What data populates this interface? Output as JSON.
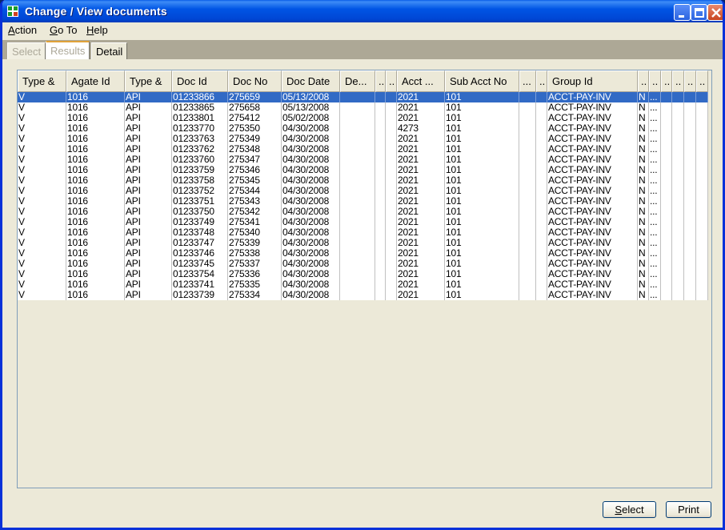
{
  "window": {
    "title": "Change / View documents"
  },
  "menu": [
    {
      "label": "Action",
      "key": "A",
      "rest": "ction"
    },
    {
      "label": "Go To",
      "key": "G",
      "rest": "o To"
    },
    {
      "label": "Help",
      "key": "H",
      "rest": "elp"
    }
  ],
  "tabs": [
    "Select",
    "Results",
    "Detail"
  ],
  "columns": [
    "Type &",
    "Agate Id",
    "Type &",
    "Doc Id",
    "Doc No",
    "Doc Date",
    "De...",
    "..",
    "..",
    "Acct ...",
    "Sub Acct No",
    "...",
    "..",
    "Group Id",
    "..",
    "..",
    "..",
    "..",
    "..",
    ".."
  ],
  "rows": [
    [
      "V",
      "1016",
      "API",
      "01233866",
      "275659",
      "05/13/2008",
      "",
      "",
      "",
      "2021",
      "101",
      "",
      "",
      "ACCT-PAY-INV",
      "N",
      "...",
      "",
      "",
      "",
      ""
    ],
    [
      "V",
      "1016",
      "API",
      "01233865",
      "275658",
      "05/13/2008",
      "",
      "",
      "",
      "2021",
      "101",
      "",
      "",
      "ACCT-PAY-INV",
      "N",
      "...",
      "",
      "",
      "",
      ""
    ],
    [
      "V",
      "1016",
      "API",
      "01233801",
      "275412",
      "05/02/2008",
      "",
      "",
      "",
      "2021",
      "101",
      "",
      "",
      "ACCT-PAY-INV",
      "N",
      "...",
      "",
      "",
      "",
      ""
    ],
    [
      "V",
      "1016",
      "API",
      "01233770",
      "275350",
      "04/30/2008",
      "",
      "",
      "",
      "4273",
      "101",
      "",
      "",
      "ACCT-PAY-INV",
      "N",
      "...",
      "",
      "",
      "",
      ""
    ],
    [
      "V",
      "1016",
      "API",
      "01233763",
      "275349",
      "04/30/2008",
      "",
      "",
      "",
      "2021",
      "101",
      "",
      "",
      "ACCT-PAY-INV",
      "N",
      "...",
      "",
      "",
      "",
      ""
    ],
    [
      "V",
      "1016",
      "API",
      "01233762",
      "275348",
      "04/30/2008",
      "",
      "",
      "",
      "2021",
      "101",
      "",
      "",
      "ACCT-PAY-INV",
      "N",
      "...",
      "",
      "",
      "",
      ""
    ],
    [
      "V",
      "1016",
      "API",
      "01233760",
      "275347",
      "04/30/2008",
      "",
      "",
      "",
      "2021",
      "101",
      "",
      "",
      "ACCT-PAY-INV",
      "N",
      "...",
      "",
      "",
      "",
      ""
    ],
    [
      "V",
      "1016",
      "API",
      "01233759",
      "275346",
      "04/30/2008",
      "",
      "",
      "",
      "2021",
      "101",
      "",
      "",
      "ACCT-PAY-INV",
      "N",
      "...",
      "",
      "",
      "",
      ""
    ],
    [
      "V",
      "1016",
      "API",
      "01233758",
      "275345",
      "04/30/2008",
      "",
      "",
      "",
      "2021",
      "101",
      "",
      "",
      "ACCT-PAY-INV",
      "N",
      "...",
      "",
      "",
      "",
      ""
    ],
    [
      "V",
      "1016",
      "API",
      "01233752",
      "275344",
      "04/30/2008",
      "",
      "",
      "",
      "2021",
      "101",
      "",
      "",
      "ACCT-PAY-INV",
      "N",
      "...",
      "",
      "",
      "",
      ""
    ],
    [
      "V",
      "1016",
      "API",
      "01233751",
      "275343",
      "04/30/2008",
      "",
      "",
      "",
      "2021",
      "101",
      "",
      "",
      "ACCT-PAY-INV",
      "N",
      "...",
      "",
      "",
      "",
      ""
    ],
    [
      "V",
      "1016",
      "API",
      "01233750",
      "275342",
      "04/30/2008",
      "",
      "",
      "",
      "2021",
      "101",
      "",
      "",
      "ACCT-PAY-INV",
      "N",
      "...",
      "",
      "",
      "",
      ""
    ],
    [
      "V",
      "1016",
      "API",
      "01233749",
      "275341",
      "04/30/2008",
      "",
      "",
      "",
      "2021",
      "101",
      "",
      "",
      "ACCT-PAY-INV",
      "N",
      "...",
      "",
      "",
      "",
      ""
    ],
    [
      "V",
      "1016",
      "API",
      "01233748",
      "275340",
      "04/30/2008",
      "",
      "",
      "",
      "2021",
      "101",
      "",
      "",
      "ACCT-PAY-INV",
      "N",
      "...",
      "",
      "",
      "",
      ""
    ],
    [
      "V",
      "1016",
      "API",
      "01233747",
      "275339",
      "04/30/2008",
      "",
      "",
      "",
      "2021",
      "101",
      "",
      "",
      "ACCT-PAY-INV",
      "N",
      "...",
      "",
      "",
      "",
      ""
    ],
    [
      "V",
      "1016",
      "API",
      "01233746",
      "275338",
      "04/30/2008",
      "",
      "",
      "",
      "2021",
      "101",
      "",
      "",
      "ACCT-PAY-INV",
      "N",
      "...",
      "",
      "",
      "",
      ""
    ],
    [
      "V",
      "1016",
      "API",
      "01233745",
      "275337",
      "04/30/2008",
      "",
      "",
      "",
      "2021",
      "101",
      "",
      "",
      "ACCT-PAY-INV",
      "N",
      "...",
      "",
      "",
      "",
      ""
    ],
    [
      "V",
      "1016",
      "API",
      "01233754",
      "275336",
      "04/30/2008",
      "",
      "",
      "",
      "2021",
      "101",
      "",
      "",
      "ACCT-PAY-INV",
      "N",
      "...",
      "",
      "",
      "",
      ""
    ],
    [
      "V",
      "1016",
      "API",
      "01233741",
      "275335",
      "04/30/2008",
      "",
      "",
      "",
      "2021",
      "101",
      "",
      "",
      "ACCT-PAY-INV",
      "N",
      "...",
      "",
      "",
      "",
      ""
    ],
    [
      "V",
      "1016",
      "API",
      "01233739",
      "275334",
      "04/30/2008",
      "",
      "",
      "",
      "2021",
      "101",
      "",
      "",
      "ACCT-PAY-INV",
      "N",
      "...",
      "",
      "",
      "",
      ""
    ]
  ],
  "selected_row": 0,
  "buttons": {
    "select": {
      "key": "S",
      "rest": "elect"
    },
    "print": "Print"
  },
  "icons": {
    "app": "app-grid-icon",
    "minimize": "minimize-icon",
    "maximize": "maximize-icon",
    "close": "close-icon"
  },
  "colors": {
    "titlebar": "#0055e5",
    "selection": "#316ac5",
    "window": "#ece9d8"
  }
}
